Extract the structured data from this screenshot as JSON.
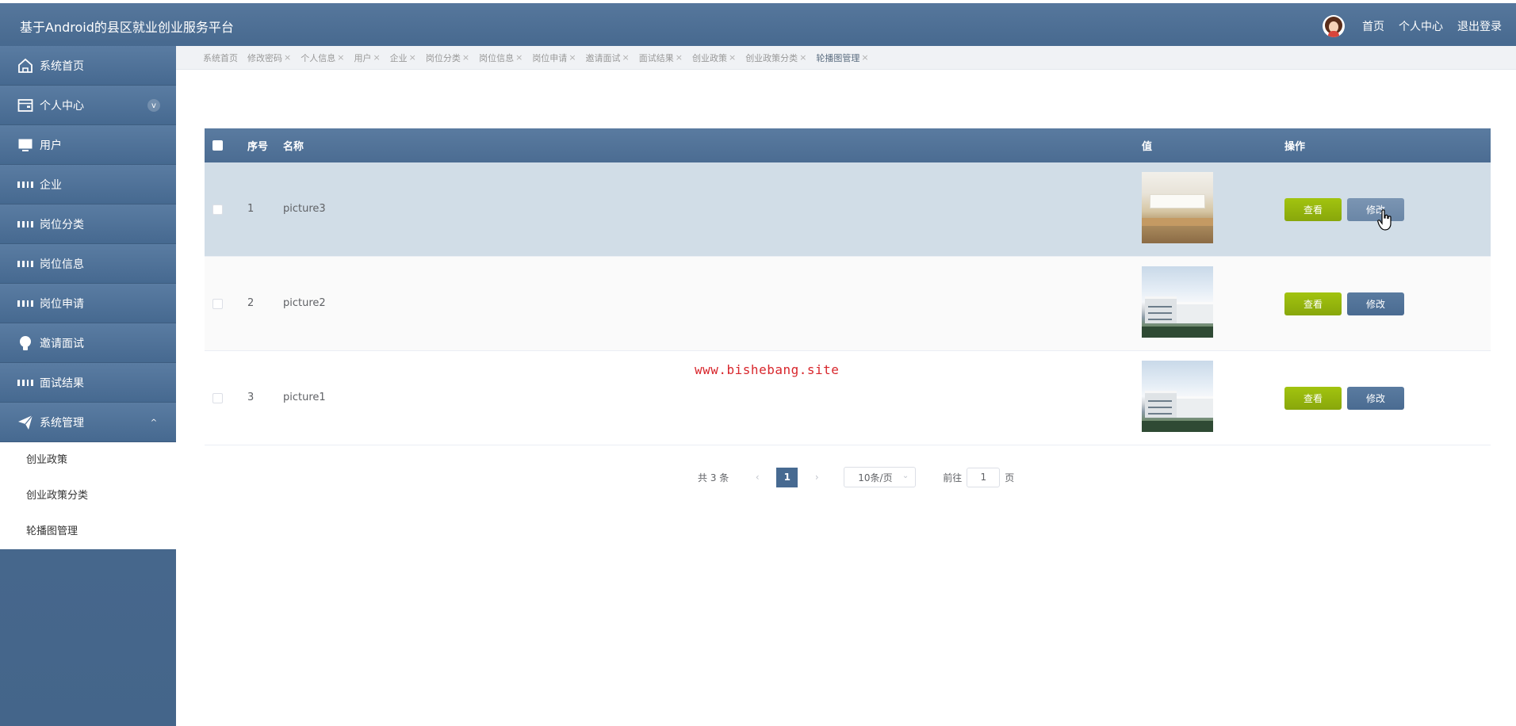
{
  "app": {
    "title": "基于Android的县区就业创业服务平台"
  },
  "header": {
    "links": [
      "首页",
      "个人中心",
      "退出登录"
    ]
  },
  "sidebar": {
    "items": [
      {
        "label": "系统首页",
        "icon": "home-icon"
      },
      {
        "label": "个人中心",
        "icon": "wallet-icon",
        "expand": "v"
      },
      {
        "label": "用户",
        "icon": "monitor-icon"
      },
      {
        "label": "企业",
        "icon": "grid-icon"
      },
      {
        "label": "岗位分类",
        "icon": "grid-icon"
      },
      {
        "label": "岗位信息",
        "icon": "grid-icon"
      },
      {
        "label": "岗位申请",
        "icon": "grid-icon"
      },
      {
        "label": "邀请面试",
        "icon": "bulb-icon"
      },
      {
        "label": "面试结果",
        "icon": "grid-icon"
      },
      {
        "label": "系统管理",
        "icon": "paper-plane-icon",
        "expand": "^"
      }
    ],
    "submenu": [
      "创业政策",
      "创业政策分类",
      "轮播图管理"
    ]
  },
  "tabs": [
    {
      "label": "系统首页",
      "closable": false
    },
    {
      "label": "修改密码",
      "closable": true
    },
    {
      "label": "个人信息",
      "closable": true
    },
    {
      "label": "用户",
      "closable": true
    },
    {
      "label": "企业",
      "closable": true
    },
    {
      "label": "岗位分类",
      "closable": true
    },
    {
      "label": "岗位信息",
      "closable": true
    },
    {
      "label": "岗位申请",
      "closable": true
    },
    {
      "label": "邀请面试",
      "closable": true
    },
    {
      "label": "面试结果",
      "closable": true
    },
    {
      "label": "创业政策",
      "closable": true
    },
    {
      "label": "创业政策分类",
      "closable": true
    },
    {
      "label": "轮播图管理",
      "closable": true,
      "active": true
    }
  ],
  "table": {
    "headers": {
      "index": "序号",
      "name": "名称",
      "value": "值",
      "actions": "操作"
    },
    "rows": [
      {
        "index": "1",
        "name": "picture3",
        "thumb": "room"
      },
      {
        "index": "2",
        "name": "picture2",
        "thumb": "building"
      },
      {
        "index": "3",
        "name": "picture1",
        "thumb": "building"
      }
    ],
    "view_label": "查看",
    "edit_label": "修改",
    "close_glyph": "×"
  },
  "watermark": "www.bishebang.site",
  "pagination": {
    "total": "共 3 条",
    "prev": "‹",
    "current": "1",
    "next": "›",
    "page_size": "10条/页",
    "goto_label": "前往",
    "goto_value": "1",
    "page_suffix": "页"
  },
  "colors": {
    "header": "#4e7099",
    "view_button": "#95b60d",
    "edit_button": "#4f7096",
    "highlight_row": "#d1dde7"
  }
}
